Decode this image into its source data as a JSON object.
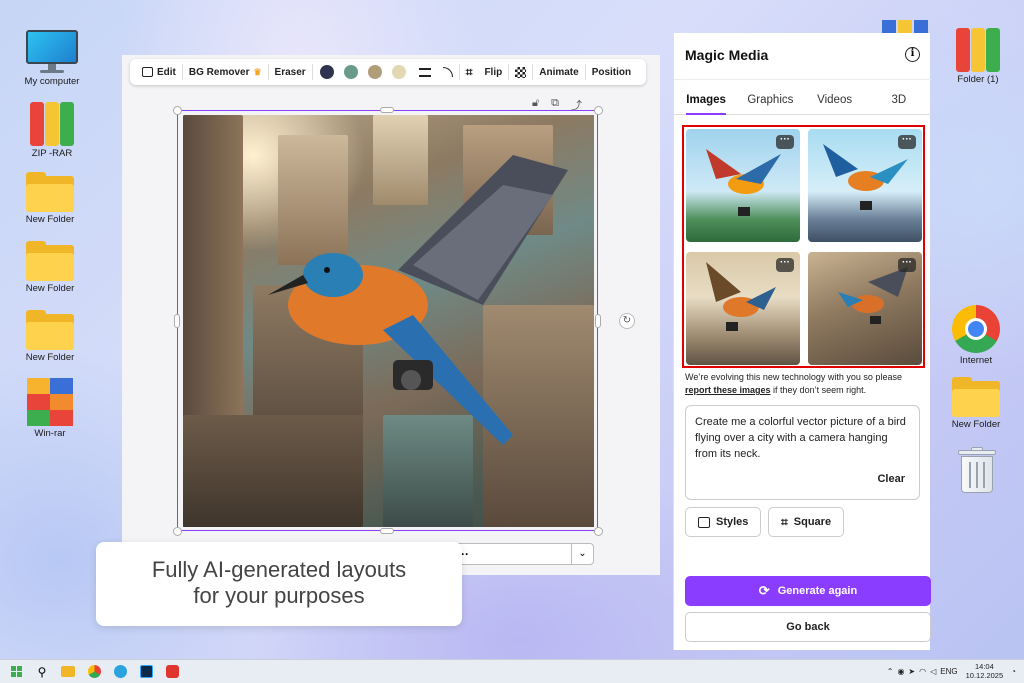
{
  "desktop": {
    "left_icons": [
      {
        "label": "My computer"
      },
      {
        "label": "ZIP -RAR"
      },
      {
        "label": "New Folder"
      },
      {
        "label": "New Folder"
      },
      {
        "label": "New Folder"
      },
      {
        "label": "Win-rar"
      }
    ],
    "right_icons": [
      {
        "label": "Folder (1)"
      },
      {
        "label": "Internet"
      },
      {
        "label": "New Folder"
      }
    ]
  },
  "editor": {
    "toolbar": {
      "edit": "Edit",
      "bg_remover": "BG Remover",
      "eraser": "Eraser",
      "colors": [
        "#2f3350",
        "#6a9a8c",
        "#b29d7a",
        "#e2d8b2"
      ],
      "flip": "Flip",
      "animate": "Animate",
      "position": "Position"
    },
    "dropdown_dots": "···"
  },
  "promo": {
    "line1": "Fully AI-generated layouts",
    "line2": "for your purposes"
  },
  "panel": {
    "title": "Magic Media",
    "tabs": [
      "Images",
      "Graphics",
      "Videos",
      "3D"
    ],
    "active_tab": "Images",
    "thumb_menu": "···",
    "notice_prefix": "We’re evolving this new technology with you so please",
    "notice_link": "report these images",
    "notice_suffix": "if they don’t seem right.",
    "prompt_text": "Create me a colorful vector picture of a bird flying over a city with a camera hanging from its neck.",
    "clear_label": "Clear",
    "styles_label": "Styles",
    "square_label": "Square",
    "generate_label": "Generate again",
    "back_label": "Go back",
    "accent": "#8b3dff",
    "highlight": "#e00000"
  },
  "taskbar": {
    "lang": "ENG",
    "time": "14:04",
    "date": "10.12.2025"
  }
}
